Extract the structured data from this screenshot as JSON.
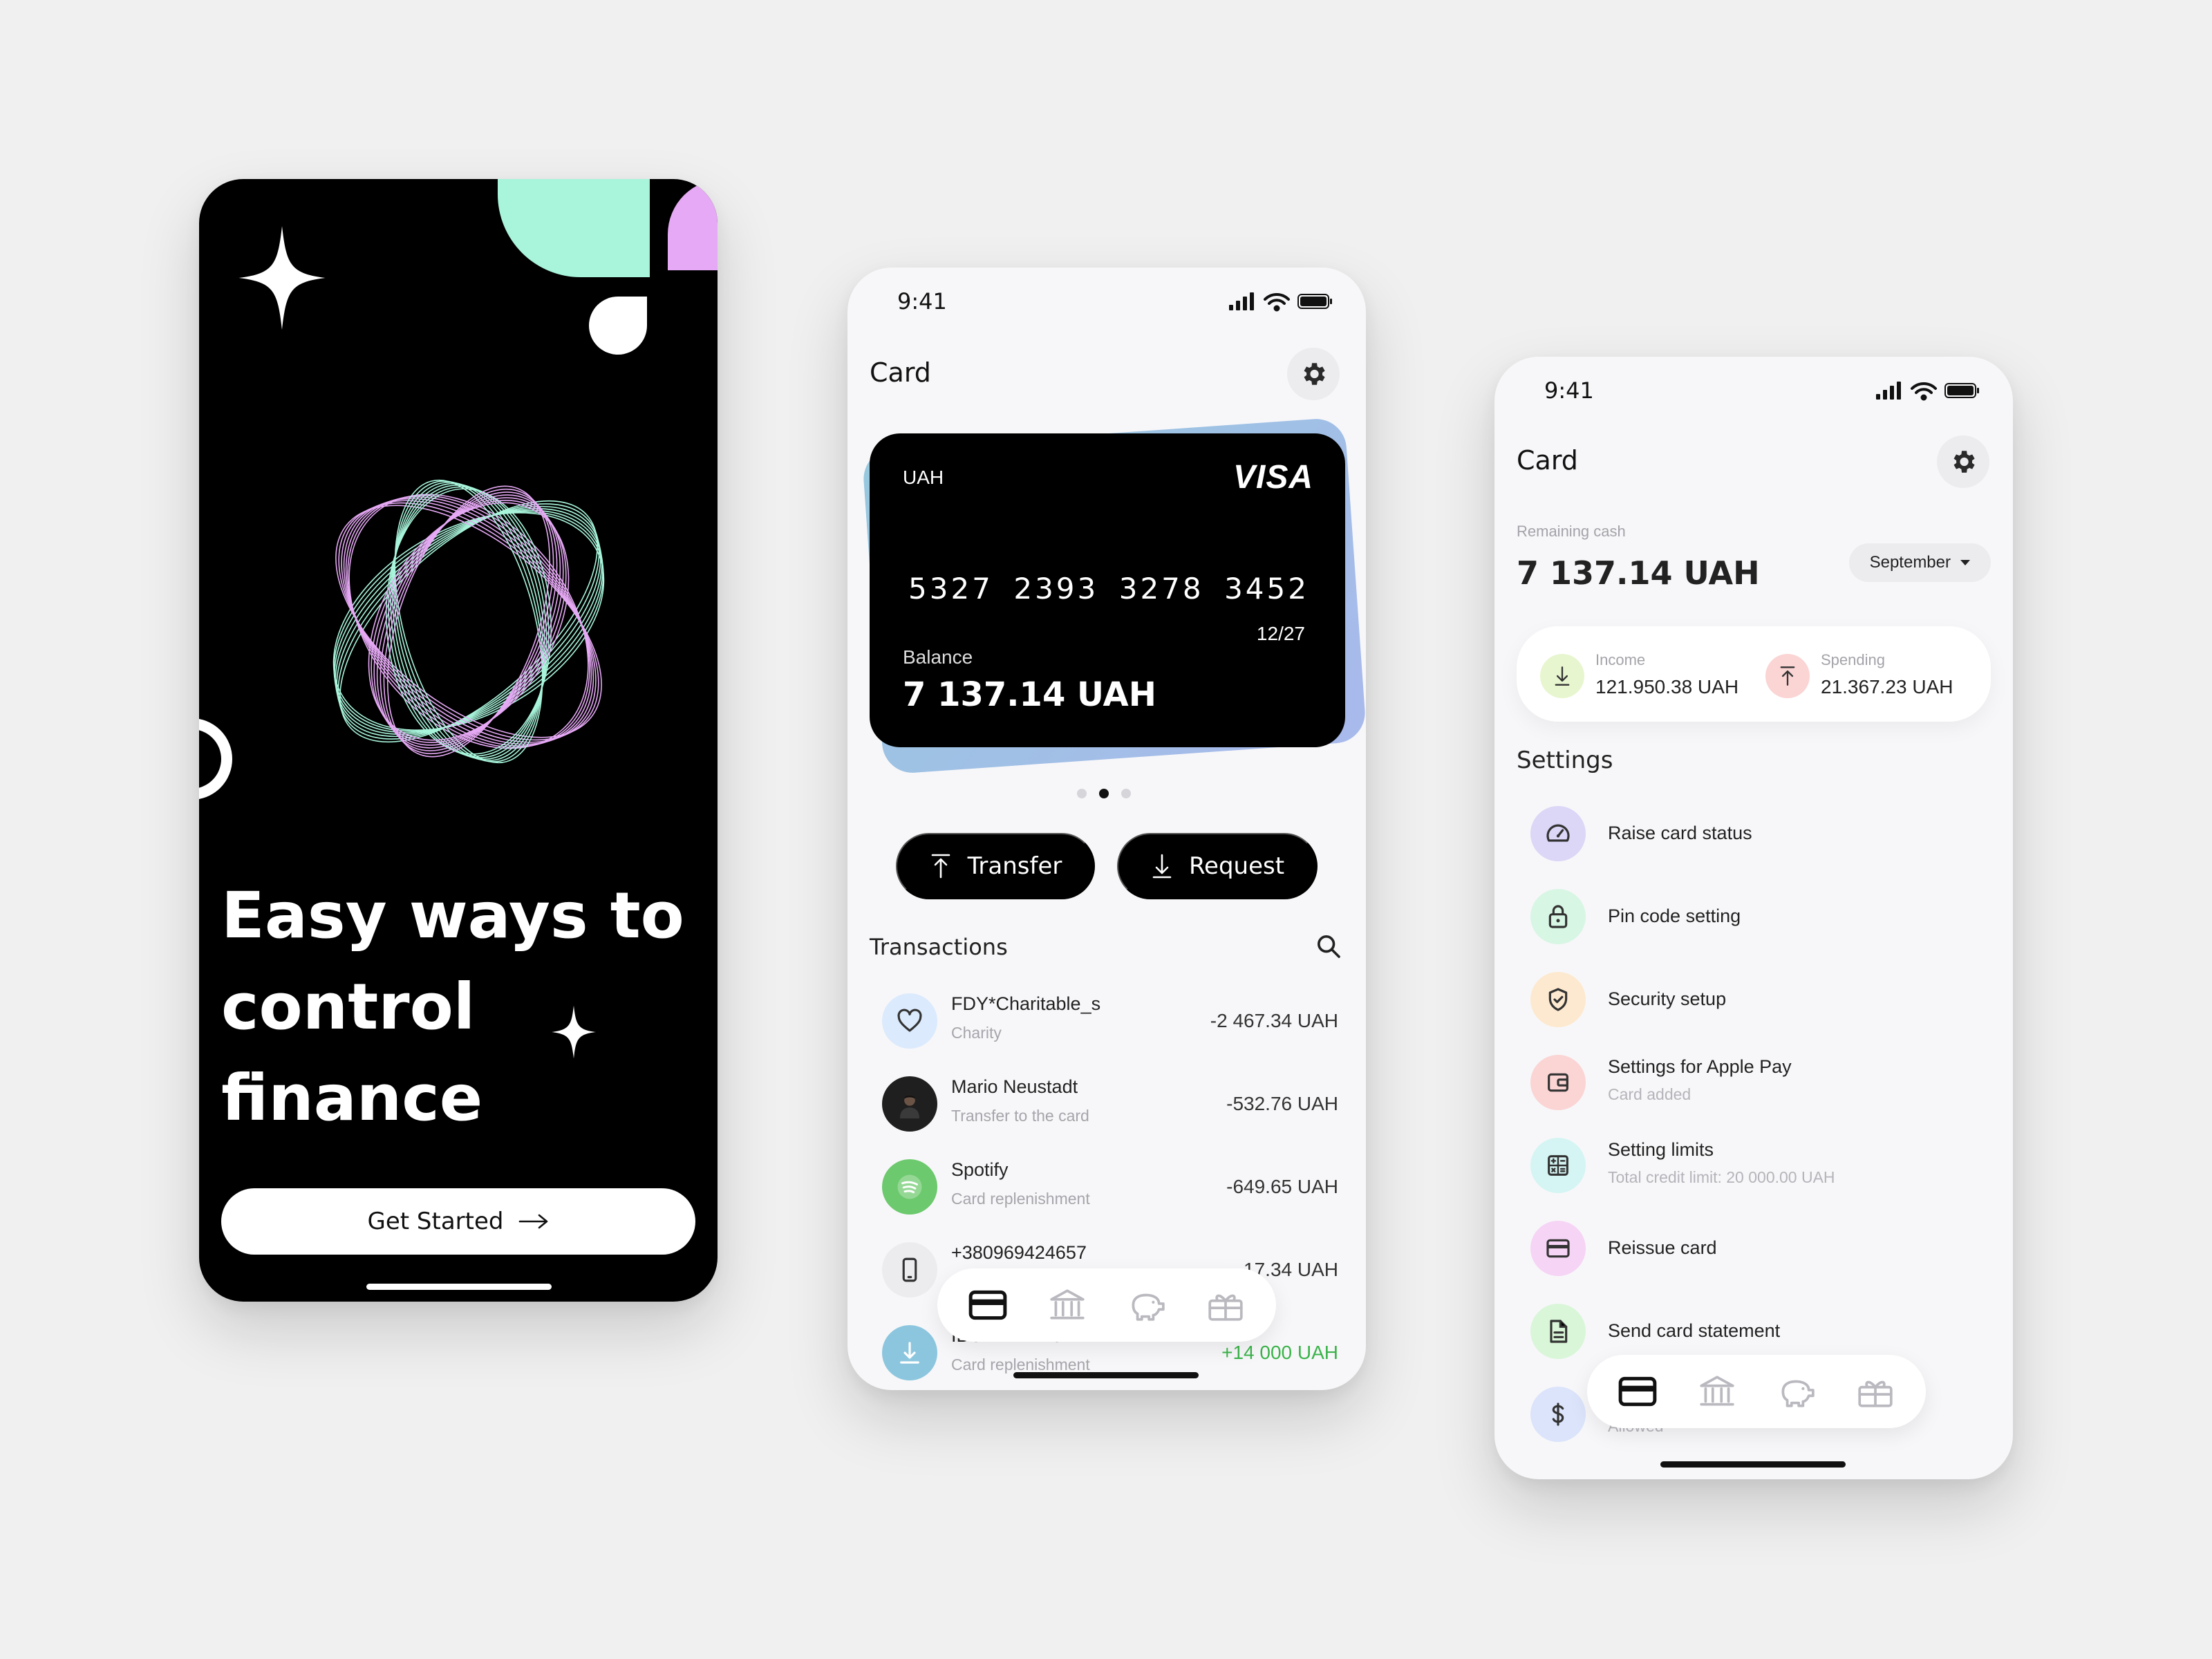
{
  "onboarding": {
    "headline": [
      "Easy ways to",
      "control",
      "finance"
    ],
    "cta_label": "Get Started"
  },
  "card_screen": {
    "status_time": "9:41",
    "title": "Card",
    "card": {
      "currency": "UAH",
      "brand": "VISA",
      "number_groups": [
        "5327",
        "2393",
        "3278",
        "3452"
      ],
      "expiry": "12/27",
      "balance_label": "Balance",
      "balance": "7 137.14 UAH"
    },
    "pager": {
      "count": 3,
      "active": 2
    },
    "transfer_label": "Transfer",
    "request_label": "Request",
    "transactions_title": "Transactions",
    "transactions": [
      {
        "name": "FDY*Charitable_s",
        "sub": "Charity",
        "amount": "-2 467.34 UAH",
        "icon": "heart-icon",
        "color": "#dbeafc"
      },
      {
        "name": "Mario Neustadt",
        "sub": "Transfer to the card",
        "amount": "-532.76 UAH",
        "icon": "avatar-photo",
        "color": "#1f1f1f"
      },
      {
        "name": "Spotify",
        "sub": "Card replenishment",
        "amount": "-649.65 UAH",
        "icon": "spotify-icon",
        "color": "#6cc96d"
      },
      {
        "name": "+380969424657",
        "sub": "",
        "amount": "-17.34 UAH",
        "icon": "phone-icon",
        "color": "#ececef"
      },
      {
        "name": "IBOXBANK 02",
        "sub": "Card replenishment",
        "amount": "+14 000 UAH",
        "icon": "download-icon",
        "color": "#8cc6de",
        "positive": true
      }
    ],
    "tabbar": [
      "card-icon",
      "bank-icon",
      "piggy-bank-icon",
      "gift-icon"
    ]
  },
  "settings_screen": {
    "status_time": "9:41",
    "title": "Card",
    "remaining_label": "Remaining cash",
    "remaining_value": "7 137.14 UAH",
    "month": "September",
    "income_label": "Income",
    "income_value": "121.950.38 UAH",
    "spending_label": "Spending",
    "spending_value": "21.367.23 UAH",
    "settings_title": "Settings",
    "settings": [
      {
        "label": "Raise card status",
        "sub": "",
        "icon": "speedometer-icon",
        "color": "#dcd6f7"
      },
      {
        "label": "Pin code setting",
        "sub": "",
        "icon": "lock-icon",
        "color": "#d8f6e4"
      },
      {
        "label": "Security setup",
        "sub": "",
        "icon": "shield-icon",
        "color": "#fde9cf"
      },
      {
        "label": "Settings for Apple Pay",
        "sub": "Card added",
        "icon": "wallet-icon",
        "color": "#fbd4d4"
      },
      {
        "label": "Setting limits",
        "sub": "Total credit limit: 20 000.00 UAH",
        "icon": "calculator-icon",
        "color": "#d4f5f3"
      },
      {
        "label": "Reissue card",
        "sub": "",
        "icon": "card-icon",
        "color": "#f6d4f5"
      },
      {
        "label": "Send card statement",
        "sub": "",
        "icon": "document-icon",
        "color": "#d9f6d9"
      },
      {
        "label": "",
        "sub": "Allowed",
        "icon": "dollar-icon",
        "color": "#dbe4fb"
      }
    ],
    "tabbar": [
      "card-icon",
      "bank-icon",
      "piggy-bank-icon",
      "gift-icon"
    ]
  },
  "colors": {
    "mint": "#a8f5db",
    "lilac": "#e6a9f5",
    "positive": "#3bb34a"
  }
}
